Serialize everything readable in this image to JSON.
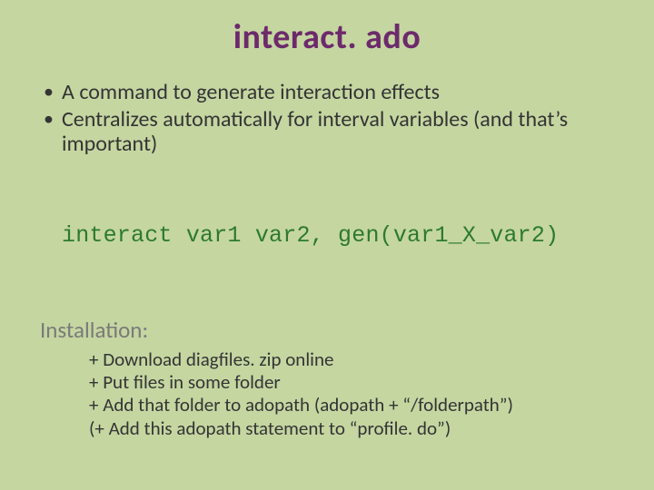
{
  "title": "interact. ado",
  "bullets": [
    "A command to generate interaction effects",
    "Centralizes automatically for interval variables (and that’s important)"
  ],
  "code_line": "interact var1 var2, gen(var1_X_var2)",
  "install_label": "Installation:",
  "install_steps": [
    "+ Download diagfiles. zip online",
    "+ Put files in some folder",
    "+ Add that folder to adopath (adopath + “/folderpath”)",
    "(+ Add this adopath statement to “profile. do”)"
  ]
}
